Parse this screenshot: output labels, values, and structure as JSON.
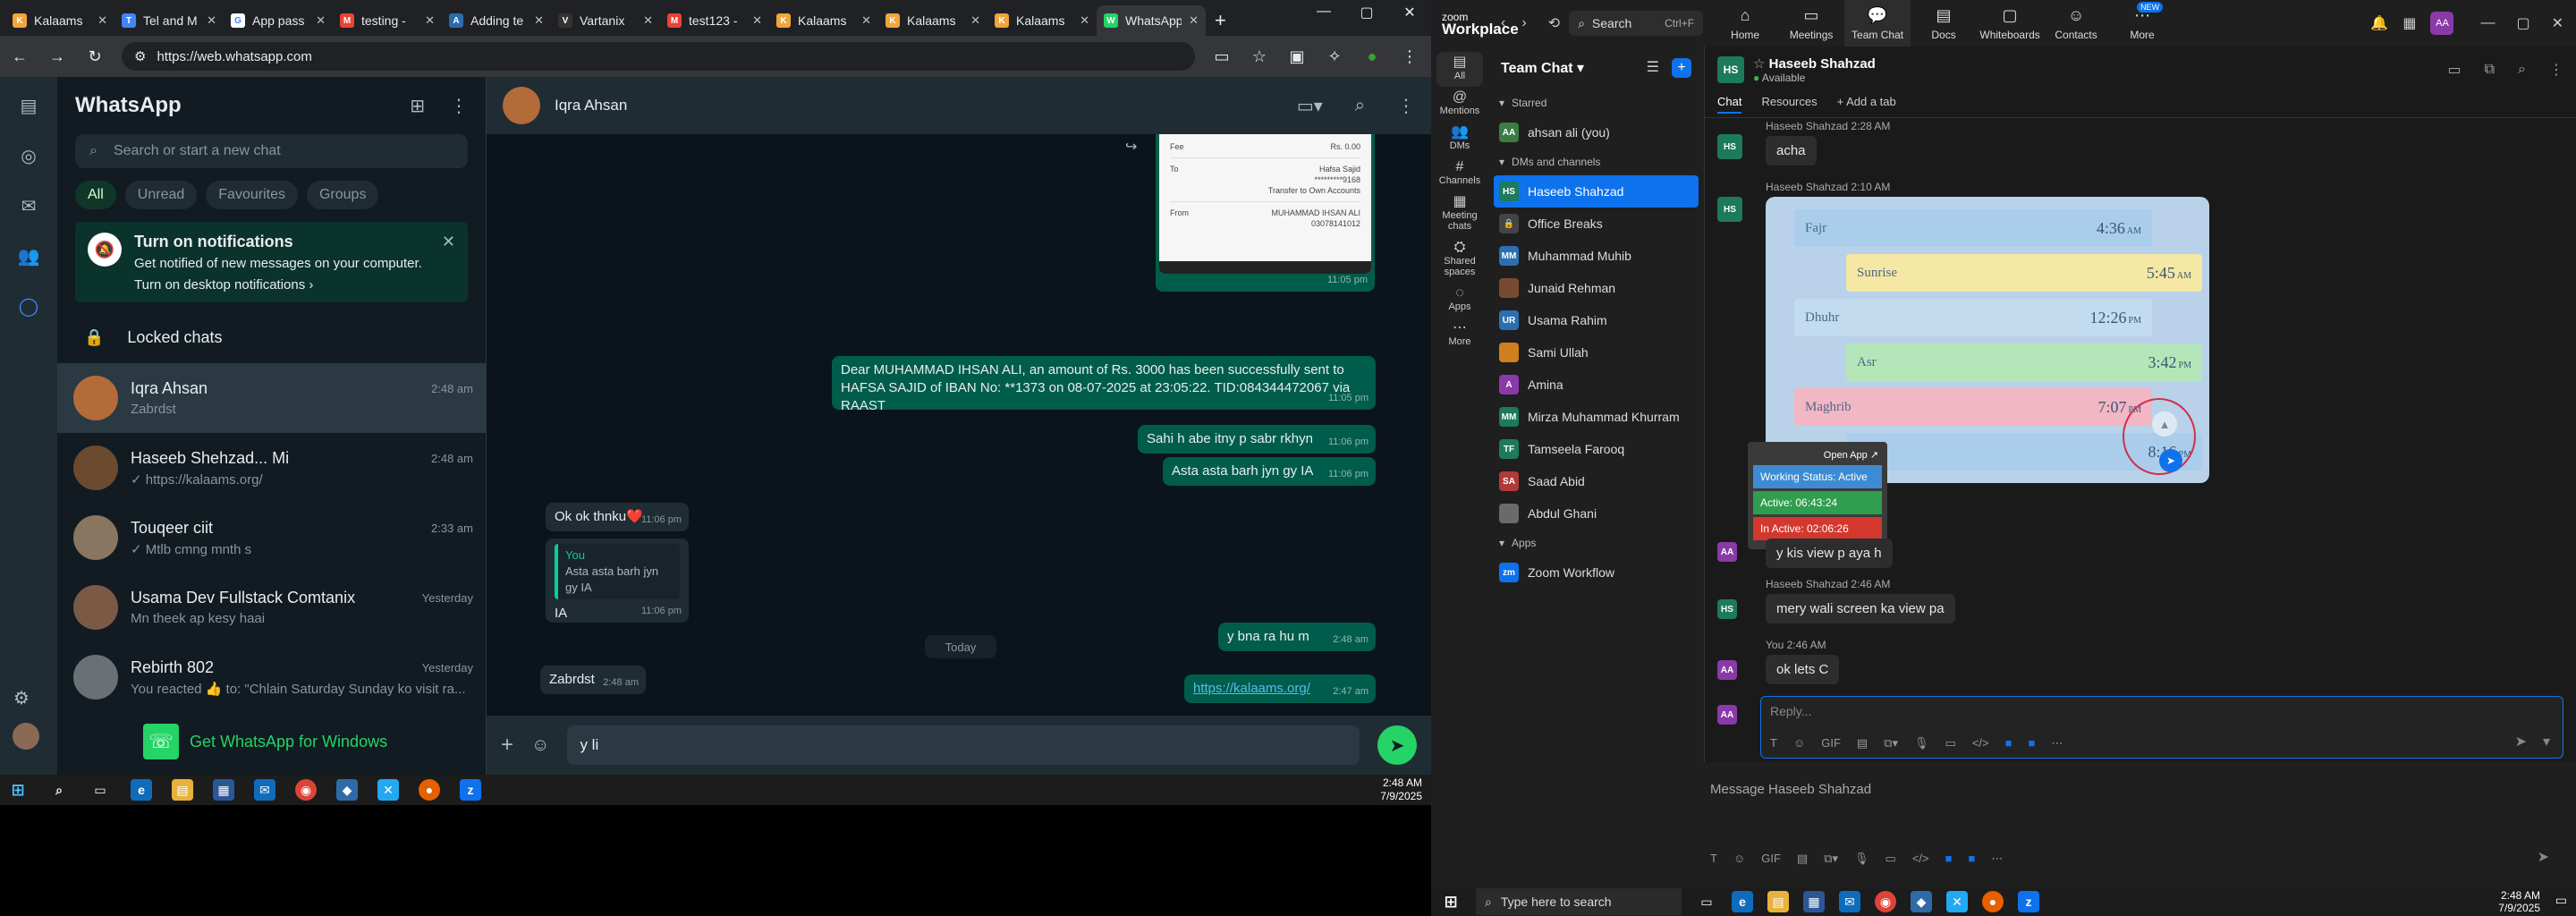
{
  "colors": {
    "wa_green": "#25d366",
    "wa_out": "#005c4b",
    "wa_in": "#202c33",
    "zoom_blue": "#0e72ed"
  },
  "browser": {
    "tabs": [
      {
        "title": "Kalaams",
        "color": "#f0a63a",
        "icon": "K"
      },
      {
        "title": "Tel and M",
        "color": "#4285f4",
        "icon": "T"
      },
      {
        "title": "App pass",
        "color": "#ffffff",
        "icon": "G"
      },
      {
        "title": "testing -",
        "color": "#ea4335",
        "icon": "M"
      },
      {
        "title": "Adding te",
        "color": "#2b6cb0",
        "icon": "A"
      },
      {
        "title": "Vartanix",
        "color": "#333333",
        "icon": "V"
      },
      {
        "title": "test123 -",
        "color": "#ea4335",
        "icon": "M"
      },
      {
        "title": "Kalaams",
        "color": "#f0a63a",
        "icon": "K"
      },
      {
        "title": "Kalaams",
        "color": "#f0a63a",
        "icon": "K"
      },
      {
        "title": "Kalaams",
        "color": "#f0a63a",
        "icon": "K"
      },
      {
        "title": "WhatsApp",
        "color": "#25d366",
        "icon": "W"
      }
    ],
    "url": "https://web.whatsapp.com"
  },
  "whatsapp": {
    "title": "WhatsApp",
    "search_placeholder": "Search or start a new chat",
    "filters": [
      "All",
      "Unread",
      "Favourites",
      "Groups"
    ],
    "notif_title": "Turn on notifications",
    "notif_desc": "Get notified of new messages on your computer.",
    "notif_link": "Turn on desktop notifications ›",
    "locked": "Locked chats",
    "chats": [
      {
        "name": "Iqra Ahsan",
        "time": "2:48 am",
        "preview": "Zabrdst",
        "color": "#b36b3a"
      },
      {
        "name": "Haseeb Shehzad... Mi",
        "time": "2:48 am",
        "preview": "✓ https://kalaams.org/",
        "color": "#6b4a2f"
      },
      {
        "name": "Touqeer ciit",
        "time": "2:33 am",
        "preview": "✓ Mtlb cmng mnth s",
        "color": "#8a7560"
      },
      {
        "name": "Usama Dev Fullstack Comtanix",
        "time": "Yesterday",
        "preview": "Mn theek ap kesy haai",
        "color": "#7a5a44"
      },
      {
        "name": "Rebirth 802",
        "time": "Yesterday",
        "preview": "You reacted 👍 to: \"Chlain Saturday Sunday ko visit ra...",
        "color": "#6a7175"
      }
    ],
    "get_windows": "Get WhatsApp for Windows",
    "conv_name": "Iqra Ahsan",
    "receipt": {
      "fee_label": "Fee",
      "fee_value": "Rs. 0.00",
      "to_label": "To",
      "to_name": "Hafsa Sajid",
      "to_acct": "*********9168",
      "to_note": "Transfer to Own Accounts",
      "from_label": "From",
      "from_name": "MUHAMMAD IHSAN ALI",
      "from_acct": "03078141012"
    },
    "messages": [
      {
        "dir": "out",
        "text": "",
        "time": "11:05 pm"
      },
      {
        "dir": "out",
        "text": "Dear MUHAMMAD IHSAN ALI, an amount of Rs. 3000 has been successfully sent to HAFSA SAJID of IBAN No: **1373 on 08-07-2025 at 23:05:22. TID:084344472067 via RAAST",
        "time": "11:05 pm"
      },
      {
        "dir": "out",
        "text": "Sahi h abe itny p sabr rkhyn",
        "time": "11:06 pm"
      },
      {
        "dir": "out",
        "text": "Asta asta barh jyn gy IA",
        "time": "11:06 pm"
      },
      {
        "dir": "in",
        "text": "Ok ok thnku❤️",
        "time": "11:06 pm"
      },
      {
        "dir": "in",
        "text": "IA",
        "time": "11:06 pm",
        "quote_name": "You",
        "quote_text": "Asta asta barh jyn gy IA"
      },
      {
        "dir": "out",
        "text": "https://kalaams.org/",
        "time": "2:47 am"
      },
      {
        "dir": "out",
        "text": "y bna ra hu m",
        "time": "2:48 am"
      },
      {
        "dir": "in",
        "text": "Zabrdst",
        "time": "2:48 am"
      }
    ],
    "day_label": "Today",
    "draft": "y li"
  },
  "taskbar_left": {
    "time": "2:48 AM",
    "date": "7/9/2025"
  },
  "zoom": {
    "brand_top": "zoom",
    "brand": "Workplace",
    "search": "Search",
    "shortcut": "Ctrl+F",
    "nav": [
      {
        "label": "Home",
        "icon": "⌂"
      },
      {
        "label": "Meetings",
        "icon": "▭"
      },
      {
        "label": "Team Chat",
        "icon": "💬"
      },
      {
        "label": "Docs",
        "icon": "▤"
      },
      {
        "label": "Whiteboards",
        "icon": "▢"
      },
      {
        "label": "Contacts",
        "icon": "☺"
      },
      {
        "label": "More",
        "icon": "⋯"
      }
    ],
    "new_badge": "NEW",
    "user_initials": "AA",
    "rail": [
      {
        "label": "All",
        "icon": "▤"
      },
      {
        "label": "Mentions",
        "icon": "@"
      },
      {
        "label": "DMs",
        "icon": "👥"
      },
      {
        "label": "Channels",
        "icon": "#"
      },
      {
        "label": "Meeting chats",
        "icon": "▦"
      },
      {
        "label": "Shared spaces",
        "icon": "⛭"
      },
      {
        "label": "Apps",
        "icon": "◌"
      },
      {
        "label": "More",
        "icon": "⋯"
      }
    ],
    "list_title": "Team Chat",
    "starred": "Starred",
    "starred_items": [
      {
        "name": "ahsan ali (you)",
        "init": "AA",
        "color": "#3a7d44"
      }
    ],
    "dms_label": "DMs and channels",
    "dms": [
      {
        "name": "Haseeb Shahzad",
        "init": "HS",
        "color": "#1d7a5c"
      },
      {
        "name": "Office Breaks",
        "init": "🔒",
        "color": "#444"
      },
      {
        "name": "Muhammad Muhib",
        "init": "MM",
        "color": "#2c6fb0"
      },
      {
        "name": "Junaid Rehman",
        "init": "",
        "color": "#7a4a30"
      },
      {
        "name": "Usama Rahim",
        "init": "UR",
        "color": "#2c6fb0"
      },
      {
        "name": "Sami Ullah",
        "init": "",
        "color": "#d07f1c"
      },
      {
        "name": "Amina",
        "init": "A",
        "color": "#8a3aa8"
      },
      {
        "name": "Mirza Muhammad Khurram",
        "init": "MM",
        "color": "#1d7a5c"
      },
      {
        "name": "Tamseela Farooq",
        "init": "TF",
        "color": "#1d7a5c"
      },
      {
        "name": "Saad Abid",
        "init": "SA",
        "color": "#b03a3a"
      },
      {
        "name": "Abdul Ghani",
        "init": "",
        "color": "#6a6a6a"
      }
    ],
    "apps_label": "Apps",
    "apps": [
      {
        "name": "Zoom Workflow",
        "init": "zm",
        "color": "#0e72ed"
      }
    ],
    "chat_name": "Haseeb Shahzad",
    "chat_status": "Available",
    "chat_tabs": [
      "Chat",
      "Resources",
      "+ Add a tab"
    ],
    "msgs": [
      {
        "sender": "Haseeb Shahzad 2:28 AM",
        "text": "acha",
        "init": "HS"
      },
      {
        "sender": "Haseeb Shahzad 2:10 AM",
        "text": "",
        "init": "HS"
      },
      {
        "sender": "",
        "text": "y kis view p aya h",
        "init": "AA"
      },
      {
        "sender": "Haseeb Shahzad 2:46 AM",
        "text": "mery wali screen ka view pa",
        "init": "HS"
      },
      {
        "sender": "You 2:46 AM",
        "text": "ok lets C",
        "init": "AA"
      }
    ],
    "prayers": [
      {
        "name": "Fajr",
        "time": "4:36",
        "ampm": "AM",
        "bg": "#a9cdea"
      },
      {
        "name": "Sunrise",
        "time": "5:45",
        "ampm": "AM",
        "bg": "#f5e7a4"
      },
      {
        "name": "Dhuhr",
        "time": "12:26",
        "ampm": "PM",
        "bg": "#c3dbee"
      },
      {
        "name": "Asr",
        "time": "3:42",
        "ampm": "PM",
        "bg": "#b5e6b9"
      },
      {
        "name": "Maghrib",
        "time": "7:07",
        "ampm": "PM",
        "bg": "#f2b6c4"
      },
      {
        "name": "Isha",
        "time": "8:16",
        "ampm": "PM",
        "bg": "#a9cdea"
      }
    ],
    "popup": {
      "open": "Open App ↗",
      "status": "Working Status: Active",
      "active": "Active: 06:43:24",
      "inactive": "In Active: 02:06:26"
    },
    "reply_placeholder": "Reply...",
    "bottom_placeholder": "Message Haseeb Shahzad"
  },
  "taskbar_right": {
    "search": "Type here to search",
    "time": "2:48 AM",
    "date": "7/9/2025"
  }
}
